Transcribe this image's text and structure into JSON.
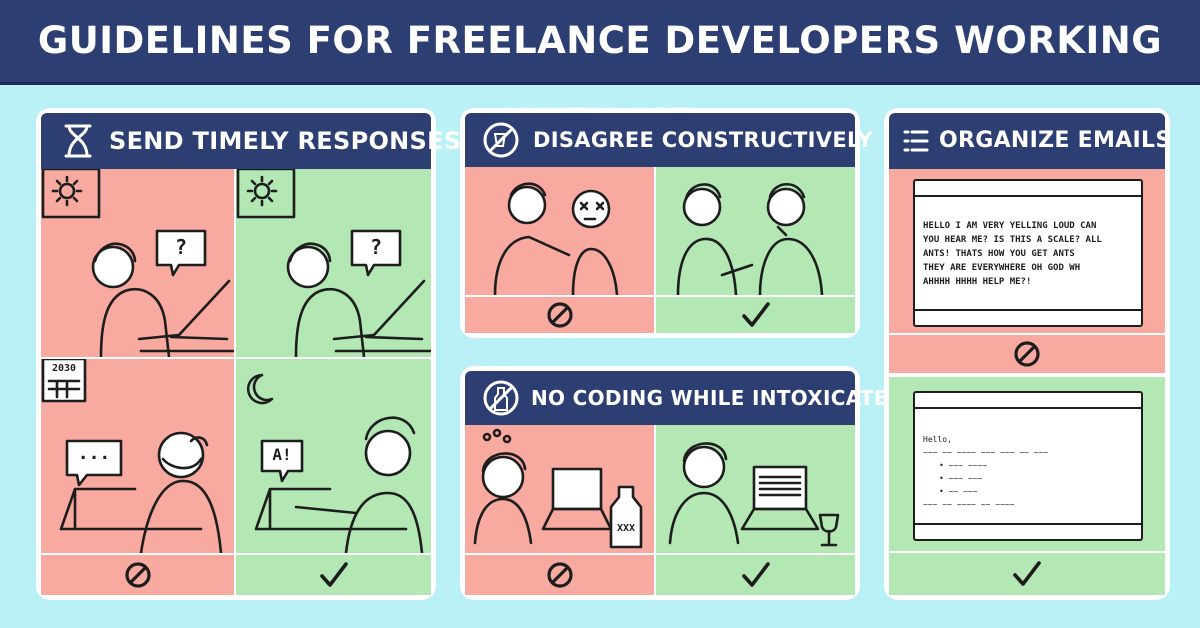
{
  "header": {
    "title": "GUIDELINES FOR FREELANCE DEVELOPERS WORKING WITH ME"
  },
  "panels": [
    {
      "title": "SEND TIMELY RESPONSES",
      "icon": "hourglass-icon",
      "bubbles": {
        "top_left": "?",
        "top_right": "?",
        "bottom_left": "...",
        "bottom_right": "A!"
      },
      "calendar": "2030",
      "verdicts": [
        "bad",
        "good",
        "bad",
        "good"
      ]
    },
    {
      "title": "DISAGREE CONSTRUCTIVELY",
      "icon": "no-fighting-icon",
      "verdicts": [
        "bad",
        "good"
      ]
    },
    {
      "title": "NO CODING WHILE INTOXICATED",
      "icon": "no-drinking-icon",
      "bottle_label": "XXX",
      "verdicts": [
        "bad",
        "good"
      ]
    },
    {
      "title": "ORGANIZE EMAILS",
      "icon": "list-icon",
      "bad_email": [
        "HELLO I AM VERY YELLING LOUD CAN",
        "YOU HEAR ME? IS THIS A SCALE? ALL",
        "ANTS! THATS HOW YOU GET ANTS",
        "THEY ARE EVERYWHERE OH GOD WH",
        "AHHHH HHHH HELP ME?!"
      ],
      "good_email": [
        "Hello,",
        "~~~ ~~ ~~~~ ~~~ ~~~ ~~ ~~~",
        "• ~~~ ~~~~",
        "• ~~~ ~~~",
        "• ~~ ~~~",
        "~~~ ~~ ~~~~ ~~ ~~~~"
      ],
      "verdicts": [
        "bad",
        "good"
      ]
    }
  ],
  "colors": {
    "background": "#b9f1f7",
    "header": "#2c3e72",
    "bad": "#f8a9a0",
    "good": "#b3e8b5"
  }
}
